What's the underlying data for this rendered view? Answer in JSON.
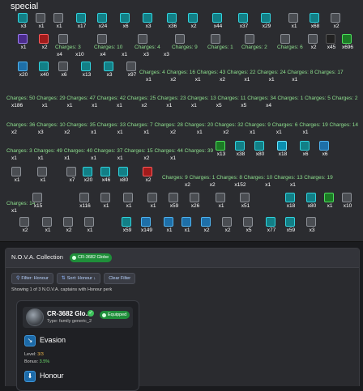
{
  "special": {
    "title": "special",
    "row1_qty": [
      "x3",
      "x1",
      "x1",
      "x17",
      "x24",
      "x6",
      "x3",
      "x36",
      "x2",
      "x44",
      "x37",
      "x29",
      "x1",
      "x68",
      "x2"
    ],
    "row2_qty": [
      "x1",
      "x2",
      "Charges: 3",
      "Charges: 10",
      "Charges: 4",
      "Charges: 9",
      "Charges: 1",
      "Charges: 2",
      "Charges: 6",
      "x2",
      "x2",
      "x45",
      "x19",
      "x696"
    ],
    "row2_sub": [
      "",
      "",
      "x4",
      "x10",
      "x4",
      "x1",
      "x3",
      "x3",
      "",
      "",
      "",
      "",
      "",
      ""
    ],
    "row3_qty": [
      "x20",
      "x40",
      "x6",
      "x13",
      "x3",
      "x97",
      "Charges: 4",
      "Charges: 16",
      "Charges: 43",
      "Charges: 22",
      "Charges: 24",
      "Charges: 8",
      "Charges: 17"
    ],
    "row3_sub": [
      "",
      "",
      "",
      "",
      "",
      "",
      "x1",
      "x2",
      "x1",
      "x2",
      "x1",
      "x1",
      "x1"
    ],
    "row4_text": "Charges: 50 Charges: 29 Charges: 47 Charges: 42 Charges: 25 Charges: 23 Charges: 13 Charges: 11 Charges: 34 Charges: 1 Charges: 5 Charges: 2",
    "row4_sub": [
      "x186",
      "x1",
      "x1",
      "x1",
      "x1",
      "x2",
      "x1",
      "x1",
      "x5",
      "x5",
      "x4"
    ],
    "row5_text": "Charges: 36 Charges: 10 Charges: 35 Charges: 33 Charges: 7 Charges: 28 Charges: 20 Charges: 32 Charges: 9 Charges: 6 Charges: 19 Charges: 14",
    "row5_sub": [
      "x2",
      "x3",
      "x2",
      "x1",
      "x1",
      "x1",
      "x2",
      "x1",
      "x2",
      "x1",
      "x1",
      "x1"
    ],
    "row6_text": "Charges: 3 Charges: 49 Charges: 40 Charges: 37 Charges: 15 Charges: 44 Charges: 39",
    "row6_qty_after": [
      "x13",
      "x38",
      "x80",
      "x18",
      "x6",
      "x6"
    ],
    "row6_sub": [
      "x1",
      "x1",
      "x1",
      "x1",
      "x1",
      "x2",
      "x1"
    ],
    "row7_qty": [
      "x1",
      "x1",
      "x7",
      "x20",
      "x46",
      "x80",
      "x2",
      "Charges: 9",
      "Charges: 1",
      "Charges: 8",
      "Charges: 10",
      "Charges: 13",
      "Charges: 19"
    ],
    "row7_sub": [
      "",
      "",
      "",
      "",
      "",
      "",
      "",
      "x2",
      "x2",
      "x152",
      "x1",
      "x1"
    ],
    "row8_qty": [
      "Charges: 14",
      "x15",
      "x116",
      "x1",
      "x1",
      "x1",
      "x59",
      "x26",
      "x1",
      "x51",
      "x18",
      "x80",
      "x1",
      "x10"
    ],
    "row8_sub": [
      "x1"
    ],
    "row9_qty": [
      "x2",
      "x1",
      "x2",
      "x1",
      "x59",
      "x149",
      "x1",
      "x1",
      "x2",
      "x2",
      "x5",
      "x77",
      "x59",
      "x3"
    ]
  },
  "nova": {
    "title": "N.O.V.A. Collection",
    "badge": "CR-3682 Globe",
    "filter_honour": "Filter: Honour",
    "sort_honour": "Sort: Honour ↓",
    "clear_filter": "Clear Filter",
    "info": "Showing 1 of 3 N.O.V.A. captains with Honour perk",
    "captain": {
      "name": "CR-3682 Glo...",
      "type": "Type: family generic_2",
      "equipped": "Equipped"
    },
    "abilities": [
      {
        "name": "Evasion",
        "level_label": "Level:",
        "level": "3/3",
        "bonus_label": "Bonus:",
        "bonus": "3.5%"
      },
      {
        "name": "Honour"
      }
    ]
  }
}
